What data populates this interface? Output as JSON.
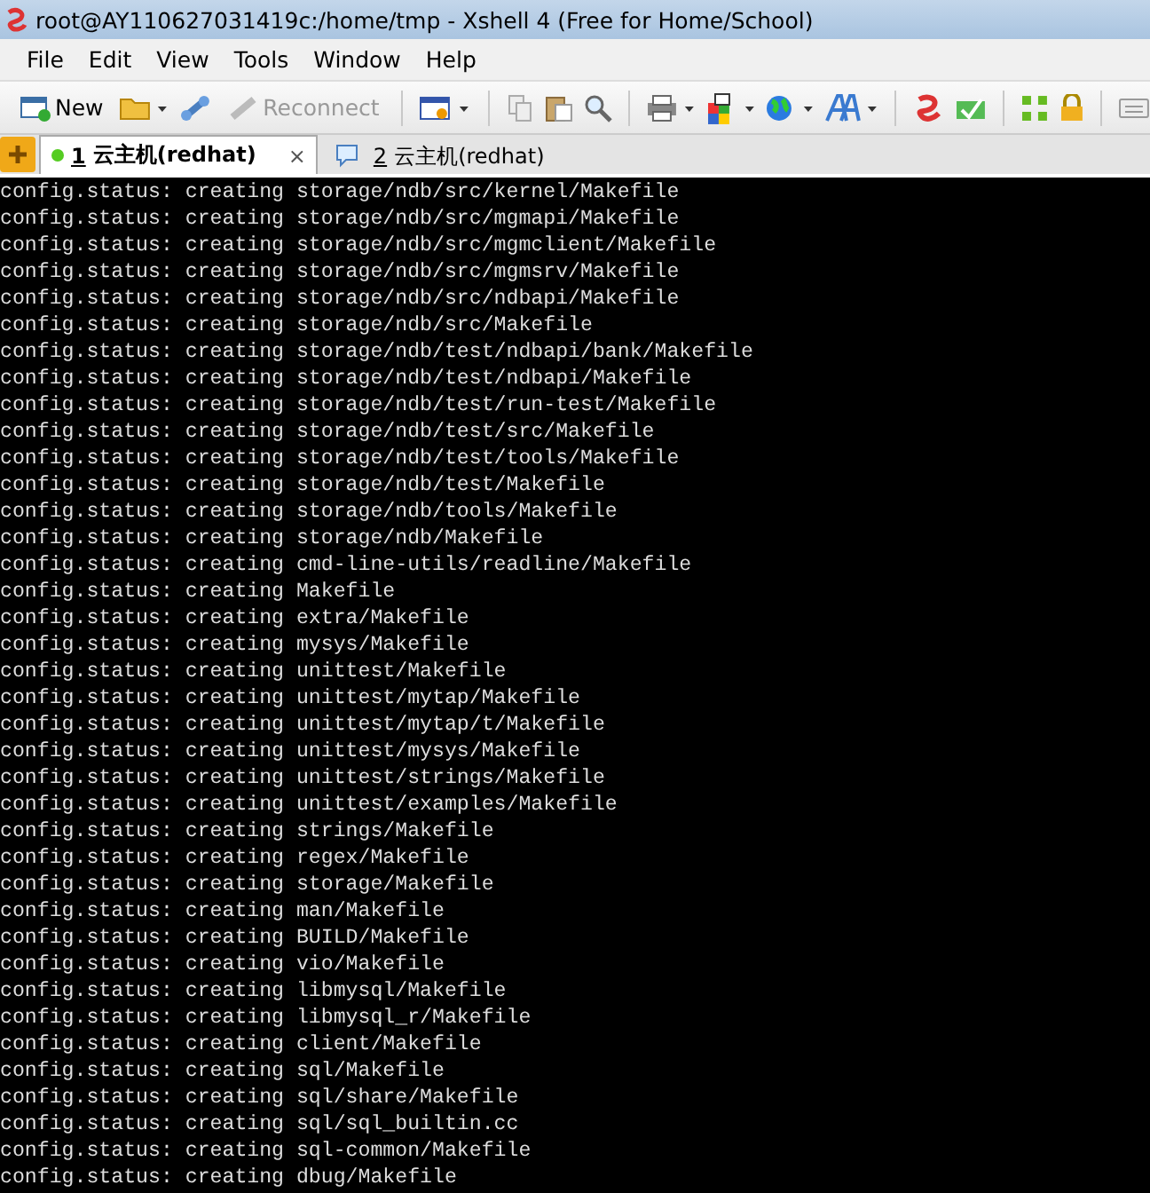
{
  "window": {
    "title": "root@AY110627031419c:/home/tmp - Xshell 4 (Free for Home/School)"
  },
  "menu": [
    "File",
    "Edit",
    "View",
    "Tools",
    "Window",
    "Help"
  ],
  "toolbar": [
    {
      "label": "New",
      "disabled": false
    },
    {
      "label": "Reconnect",
      "disabled": true
    }
  ],
  "tabs": [
    {
      "number": "1",
      "label": "云主机(redhat)",
      "selected": true,
      "close": "×"
    },
    {
      "number": "2",
      "label": "云主机(redhat)",
      "selected": false
    }
  ],
  "terminal": {
    "lines": [
      "config.status: creating storage/ndb/src/kernel/Makefile",
      "config.status: creating storage/ndb/src/mgmapi/Makefile",
      "config.status: creating storage/ndb/src/mgmclient/Makefile",
      "config.status: creating storage/ndb/src/mgmsrv/Makefile",
      "config.status: creating storage/ndb/src/ndbapi/Makefile",
      "config.status: creating storage/ndb/src/Makefile",
      "config.status: creating storage/ndb/test/ndbapi/bank/Makefile",
      "config.status: creating storage/ndb/test/ndbapi/Makefile",
      "config.status: creating storage/ndb/test/run-test/Makefile",
      "config.status: creating storage/ndb/test/src/Makefile",
      "config.status: creating storage/ndb/test/tools/Makefile",
      "config.status: creating storage/ndb/test/Makefile",
      "config.status: creating storage/ndb/tools/Makefile",
      "config.status: creating storage/ndb/Makefile",
      "config.status: creating cmd-line-utils/readline/Makefile",
      "config.status: creating Makefile",
      "config.status: creating extra/Makefile",
      "config.status: creating mysys/Makefile",
      "config.status: creating unittest/Makefile",
      "config.status: creating unittest/mytap/Makefile",
      "config.status: creating unittest/mytap/t/Makefile",
      "config.status: creating unittest/mysys/Makefile",
      "config.status: creating unittest/strings/Makefile",
      "config.status: creating unittest/examples/Makefile",
      "config.status: creating strings/Makefile",
      "config.status: creating regex/Makefile",
      "config.status: creating storage/Makefile",
      "config.status: creating man/Makefile",
      "config.status: creating BUILD/Makefile",
      "config.status: creating vio/Makefile",
      "config.status: creating libmysql/Makefile",
      "config.status: creating libmysql_r/Makefile",
      "config.status: creating client/Makefile",
      "config.status: creating sql/Makefile",
      "config.status: creating sql/share/Makefile",
      "config.status: creating sql/sql_builtin.cc",
      "config.status: creating sql-common/Makefile",
      "config.status: creating dbug/Makefile"
    ]
  }
}
